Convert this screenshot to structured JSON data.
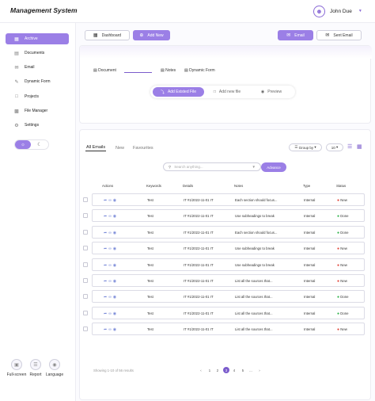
{
  "app": {
    "title": "Management System"
  },
  "user": {
    "name": "John Due",
    "avatar_icon": "user-icon"
  },
  "sidebar": {
    "items": [
      {
        "label": "Archive",
        "icon": "archive-icon",
        "active": true
      },
      {
        "label": "Documents",
        "icon": "document-icon",
        "active": false
      },
      {
        "label": "Email",
        "icon": "mail-icon",
        "active": false
      },
      {
        "label": "Dynamic Form",
        "icon": "form-icon",
        "active": false
      },
      {
        "label": "Projects",
        "icon": "folder-icon",
        "active": false
      },
      {
        "label": "File Manager",
        "icon": "file-manager-icon",
        "active": false
      },
      {
        "label": "Settings",
        "icon": "gear-icon",
        "active": false
      }
    ],
    "bottom_tools": [
      {
        "label": "Full-screen",
        "icon": "fullscreen-icon"
      },
      {
        "label": "Report",
        "icon": "report-icon"
      },
      {
        "label": "Language",
        "icon": "globe-icon"
      }
    ]
  },
  "toolbar": {
    "dashboard": "Dashboard",
    "add_new": "Add New",
    "email": "Email",
    "sent_email": "Sent Email"
  },
  "doc_tabs": [
    "Document",
    "Notes",
    "Dynamic Form"
  ],
  "segment": [
    "Add Existed File",
    "Add new file",
    "Preview"
  ],
  "mail": {
    "tabs": [
      "All Emails",
      "New",
      "Favourites"
    ],
    "search_placeholder": "Search anything...",
    "advance": "Advance",
    "group_by": "Group by",
    "per_page": "10",
    "columns": [
      "Actions",
      "Keywords",
      "Details",
      "Notes",
      "Type",
      "Status"
    ],
    "rows": [
      {
        "keyword": "Test",
        "details": "IT #1/2022-11-01 IT",
        "notes": "Each section should focus...",
        "type": "Internal",
        "status": "New"
      },
      {
        "keyword": "Test",
        "details": "IT #1/2022-11-01 IT",
        "notes": "Use subheadings to break",
        "type": "Internal",
        "status": "Done"
      },
      {
        "keyword": "Test",
        "details": "IT #1/2022-11-01 IT",
        "notes": "Each section should focus...",
        "type": "Internal",
        "status": "Done"
      },
      {
        "keyword": "Test",
        "details": "IT #1/2022-11-01 IT",
        "notes": "Use subheadings to break",
        "type": "Internal",
        "status": "New"
      },
      {
        "keyword": "Test",
        "details": "IT #1/2022-11-01 IT",
        "notes": "Use subheadings to break",
        "type": "Internal",
        "status": "New"
      },
      {
        "keyword": "Test",
        "details": "IT #1/2022-11-01 IT",
        "notes": "List all the sources that...",
        "type": "Internal",
        "status": "New"
      },
      {
        "keyword": "Test",
        "details": "IT #1/2022-11-01 IT",
        "notes": "List all the sources that...",
        "type": "Internal",
        "status": "Done"
      },
      {
        "keyword": "Test",
        "details": "IT #1/2022-11-01 IT",
        "notes": "List all the sources that...",
        "type": "Internal",
        "status": "Done"
      },
      {
        "keyword": "Test",
        "details": "IT #1/2022-11-01 IT",
        "notes": "List all the sources that...",
        "type": "Internal",
        "status": "New"
      }
    ],
    "showing": "Showing 1-10 of 56 results",
    "pages": [
      "‹",
      "1",
      "2",
      "3",
      "4",
      "5",
      "...",
      "›"
    ],
    "current_page": "3"
  },
  "colors": {
    "accent": "#9b7fe6",
    "status_new": "#e0453a",
    "status_done": "#2fb34a"
  }
}
